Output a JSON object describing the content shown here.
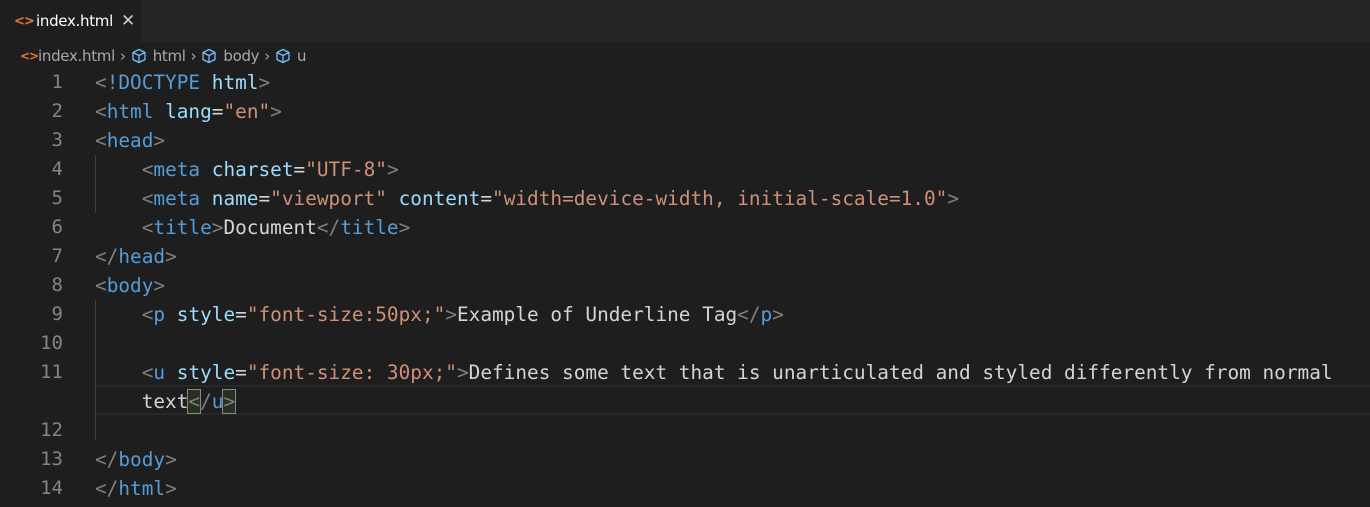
{
  "tabs": [
    {
      "label": "index.html",
      "icon": "html-file-icon",
      "active": true,
      "close_glyph": "✕"
    }
  ],
  "breadcrumb": {
    "file": "index.html",
    "items": [
      "html",
      "body",
      "u"
    ],
    "separator": "›"
  },
  "colors": {
    "tag": "#569cd6",
    "attribute": "#9cdcfe",
    "string": "#ce9178",
    "bracket": "#808080",
    "text": "#d4d4d4",
    "line_number": "#858585",
    "file_icon": "#e37933",
    "cube_icon": "#75beff"
  },
  "editor": {
    "lines": [
      {
        "n": "1",
        "tokens": [
          [
            "b",
            "<"
          ],
          [
            "t",
            "!DOCTYPE"
          ],
          [
            "x",
            " "
          ],
          [
            "a",
            "html"
          ],
          [
            "b",
            ">"
          ]
        ]
      },
      {
        "n": "2",
        "tokens": [
          [
            "b",
            "<"
          ],
          [
            "t",
            "html"
          ],
          [
            "x",
            " "
          ],
          [
            "a",
            "lang"
          ],
          [
            "x",
            "="
          ],
          [
            "s",
            "\"en\""
          ],
          [
            "b",
            ">"
          ]
        ]
      },
      {
        "n": "3",
        "tokens": [
          [
            "b",
            "<"
          ],
          [
            "t",
            "head"
          ],
          [
            "b",
            ">"
          ]
        ]
      },
      {
        "n": "4",
        "tokens": [
          [
            "x",
            "    "
          ],
          [
            "b",
            "<"
          ],
          [
            "t",
            "meta"
          ],
          [
            "x",
            " "
          ],
          [
            "a",
            "charset"
          ],
          [
            "x",
            "="
          ],
          [
            "s",
            "\"UTF-8\""
          ],
          [
            "b",
            ">"
          ]
        ]
      },
      {
        "n": "5",
        "tokens": [
          [
            "x",
            "    "
          ],
          [
            "b",
            "<"
          ],
          [
            "t",
            "meta"
          ],
          [
            "x",
            " "
          ],
          [
            "a",
            "name"
          ],
          [
            "x",
            "="
          ],
          [
            "s",
            "\"viewport\""
          ],
          [
            "x",
            " "
          ],
          [
            "a",
            "content"
          ],
          [
            "x",
            "="
          ],
          [
            "s",
            "\"width=device-width, initial-scale=1.0\""
          ],
          [
            "b",
            ">"
          ]
        ]
      },
      {
        "n": "6",
        "tokens": [
          [
            "x",
            "    "
          ],
          [
            "b",
            "<"
          ],
          [
            "t",
            "title"
          ],
          [
            "b",
            ">"
          ],
          [
            "x",
            "Document"
          ],
          [
            "b",
            "</"
          ],
          [
            "t",
            "title"
          ],
          [
            "b",
            ">"
          ]
        ]
      },
      {
        "n": "7",
        "tokens": [
          [
            "b",
            "</"
          ],
          [
            "t",
            "head"
          ],
          [
            "b",
            ">"
          ]
        ]
      },
      {
        "n": "8",
        "tokens": [
          [
            "b",
            "<"
          ],
          [
            "t",
            "body"
          ],
          [
            "b",
            ">"
          ]
        ]
      },
      {
        "n": "9",
        "tokens": [
          [
            "x",
            "    "
          ],
          [
            "b",
            "<"
          ],
          [
            "t",
            "p"
          ],
          [
            "x",
            " "
          ],
          [
            "a",
            "style"
          ],
          [
            "x",
            "="
          ],
          [
            "s",
            "\"font-size:50px;\""
          ],
          [
            "b",
            ">"
          ],
          [
            "x",
            "Example of Underline Tag"
          ],
          [
            "b",
            "</"
          ],
          [
            "t",
            "p"
          ],
          [
            "b",
            ">"
          ]
        ]
      },
      {
        "n": "10",
        "tokens": []
      },
      {
        "n": "11",
        "tokens": [
          [
            "x",
            "    "
          ],
          [
            "b",
            "<"
          ],
          [
            "t",
            "u"
          ],
          [
            "x",
            " "
          ],
          [
            "a",
            "style"
          ],
          [
            "x",
            "="
          ],
          [
            "s",
            "\"font-size: 30px;\""
          ],
          [
            "b",
            ">"
          ],
          [
            "x",
            "Defines some text that is unarticulated and styled differently from normal"
          ]
        ]
      },
      {
        "n": "",
        "tokens": [
          [
            "x",
            "    text"
          ],
          [
            "m",
            "<"
          ],
          [
            "b",
            "/"
          ],
          [
            "t",
            "u"
          ],
          [
            "m",
            ">"
          ]
        ]
      },
      {
        "n": "12",
        "tokens": []
      },
      {
        "n": "13",
        "tokens": [
          [
            "b",
            "</"
          ],
          [
            "t",
            "body"
          ],
          [
            "b",
            ">"
          ]
        ]
      },
      {
        "n": "14",
        "tokens": [
          [
            "b",
            "</"
          ],
          [
            "t",
            "html"
          ],
          [
            "b",
            ">"
          ]
        ]
      }
    ]
  }
}
